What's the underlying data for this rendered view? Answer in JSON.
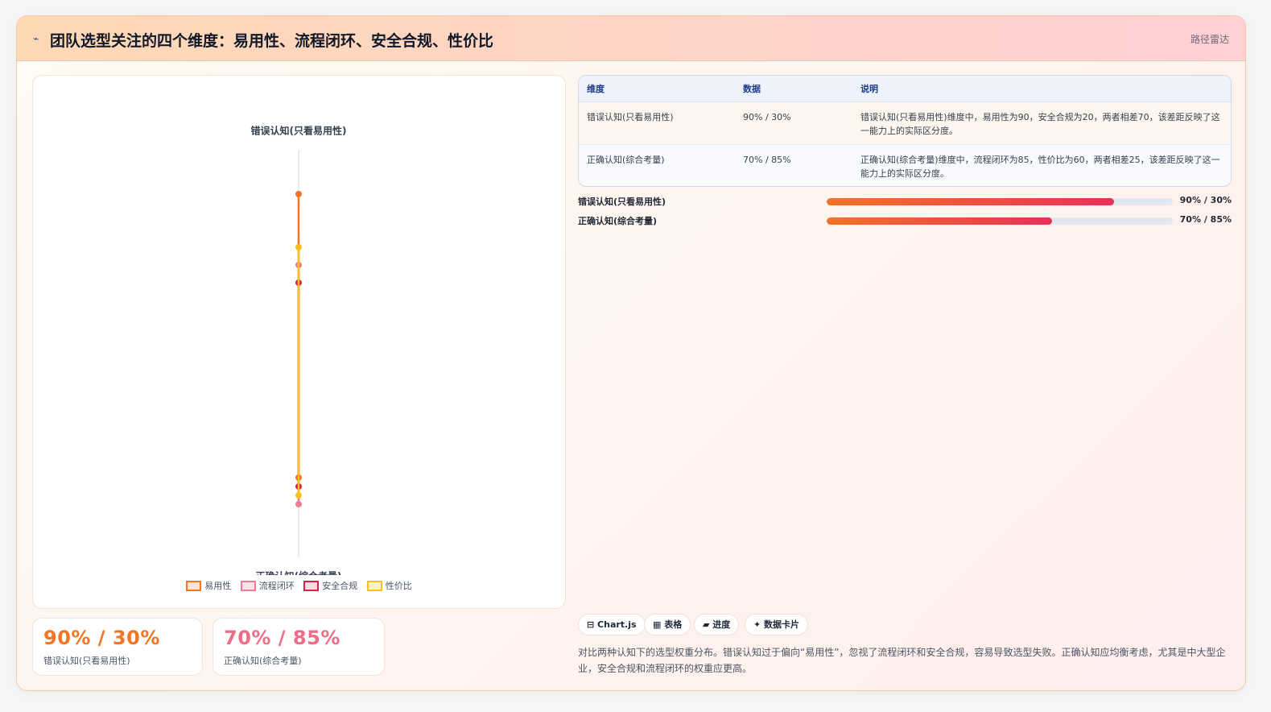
{
  "header": {
    "icon": "chart-line-icon",
    "title": "团队选型关注的四个维度：易用性、流程闭环、安全合规、性价比",
    "tag": "路径雷达"
  },
  "chart_data": {
    "type": "radar",
    "title": "",
    "axes": [
      "错误认知(只看易用性)",
      "正确认知(综合考量)"
    ],
    "range": [
      0,
      100
    ],
    "series": [
      {
        "name": "易用性",
        "values": [
          90,
          70
        ],
        "color": "#f07524"
      },
      {
        "name": "流程闭环",
        "values": [
          50,
          85
        ],
        "color": "#ee7a95"
      },
      {
        "name": "安全合规",
        "values": [
          40,
          75
        ],
        "color": "#d9224a"
      },
      {
        "name": "性价比",
        "values": [
          60,
          80
        ],
        "color": "#fbbf24"
      }
    ],
    "legend_position": "bottom"
  },
  "kpis": [
    {
      "value": "90% / 30%",
      "label": "错误认知(只看易用性)",
      "color": "#f07524"
    },
    {
      "value": "70% / 85%",
      "label": "正确认知(综合考量)",
      "color": "#ee6d86"
    }
  ],
  "table": {
    "headers": [
      "维度",
      "数据",
      "说明"
    ],
    "rows": [
      {
        "dim": "错误认知(只看易用性)",
        "data": "90% / 30%",
        "note": "错误认知(只看易用性)维度中，易用性为90，安全合规为20，两者相差70，该差距反映了这一能力上的实际区分度。"
      },
      {
        "dim": "正确认知(综合考量)",
        "data": "70% / 85%",
        "note": "正确认知(综合考量)维度中，流程闭环为85，性价比为60，两者相差25，该差距反映了这一能力上的实际区分度。"
      }
    ]
  },
  "bars": [
    {
      "label": "错误认知(只看易用性)",
      "value_text": "90% / 30%",
      "fill": 0.83
    },
    {
      "label": "正确认知(综合考量)",
      "value_text": "70% / 85%",
      "fill": 0.65
    }
  ],
  "chips": [
    "⊟ Chart.js",
    "▦ 表格",
    "▰ 进度",
    "✦ 数据卡片"
  ],
  "description": "对比两种认知下的选型权重分布。错误认知过于偏向“易用性”，忽视了流程闭环和安全合规，容易导致选型失败。正确认知应均衡考虑，尤其是中大型企业，安全合规和流程闭环的权重应更高。"
}
